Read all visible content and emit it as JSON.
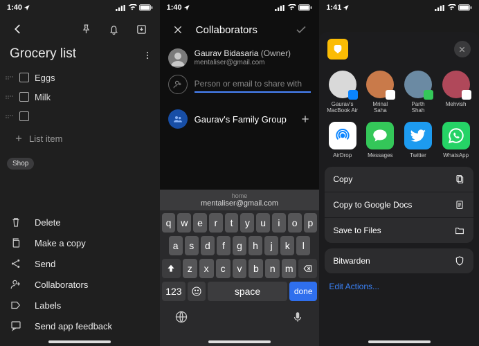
{
  "screen1": {
    "time": "1:40",
    "title": "Grocery list",
    "items": [
      "Eggs",
      "Milk",
      ""
    ],
    "addLabel": "List item",
    "chip": "Shop",
    "menu": [
      {
        "label": "Delete",
        "icon": "trash"
      },
      {
        "label": "Make a copy",
        "icon": "copy"
      },
      {
        "label": "Send",
        "icon": "share"
      },
      {
        "label": "Collaborators",
        "icon": "person-add"
      },
      {
        "label": "Labels",
        "icon": "label"
      },
      {
        "label": "Send app feedback",
        "icon": "feedback"
      }
    ]
  },
  "screen2": {
    "time": "1:40",
    "headerTitle": "Collaborators",
    "ownerName": "Gaurav Bidasaria",
    "ownerSuffix": "(Owner)",
    "ownerEmail": "mentaliser@gmail.com",
    "inputPlaceholder": "Person or email to share with",
    "groupName": "Gaurav's Family Group",
    "suggestionLabel": "home",
    "suggestionValue": "mentaliser@gmail.com",
    "keyboard": {
      "row1": [
        "q",
        "w",
        "e",
        "r",
        "t",
        "y",
        "u",
        "i",
        "o",
        "p"
      ],
      "row2": [
        "a",
        "s",
        "d",
        "f",
        "g",
        "h",
        "j",
        "k",
        "l"
      ],
      "row3": [
        "z",
        "x",
        "c",
        "v",
        "b",
        "n",
        "m"
      ],
      "numKey": "123",
      "space": "space",
      "done": "done"
    }
  },
  "screen3": {
    "time": "1:41",
    "people": [
      {
        "name": "Gaurav's\nMacBook Air",
        "bg": "#d9d9d9",
        "badge": "#0a84ff"
      },
      {
        "name": "Mrinal\nSaha",
        "bg": "#c97a4a",
        "badge": "#fff"
      },
      {
        "name": "Parth\nShah",
        "bg": "#6b8aa3",
        "badge": "#34c759"
      },
      {
        "name": "Mehvish",
        "bg": "#b0485a",
        "badge": "#fff"
      }
    ],
    "apps": [
      {
        "name": "AirDrop",
        "bg": "#fff",
        "fg": "#0a84ff",
        "icon": "airdrop"
      },
      {
        "name": "Messages",
        "bg": "#34c759",
        "fg": "#fff",
        "icon": "message"
      },
      {
        "name": "Twitter",
        "bg": "#1d9bf0",
        "fg": "#fff",
        "icon": "twitter"
      },
      {
        "name": "WhatsApp",
        "bg": "#25d366",
        "fg": "#fff",
        "icon": "whatsapp"
      }
    ],
    "actions": [
      "Copy",
      "Copy to Google Docs",
      "Save to Files"
    ],
    "action_icons": [
      "copy-pages",
      "doc",
      "folder"
    ],
    "singleAction": "Bitwarden",
    "editLink": "Edit Actions..."
  }
}
